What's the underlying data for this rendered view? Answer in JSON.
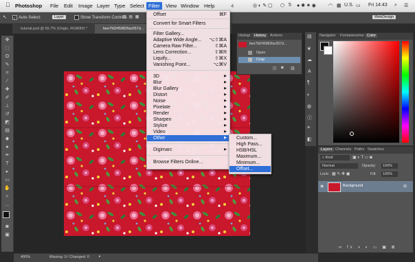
{
  "menubar": {
    "apple": "",
    "items": [
      "Photoshop",
      "File",
      "Edit",
      "Image",
      "Layer",
      "Type",
      "Select",
      "Filter",
      "View",
      "Window",
      "Help"
    ],
    "partial_title": "4",
    "tray": {
      "flag": "U.S.",
      "clock": "Fri 14:43",
      "badge": "5"
    }
  },
  "optionsbar": {
    "auto_select": "Auto-Select:",
    "auto_select_value": "Layer",
    "transform": "Show Transform Controls",
    "workspace": "WebDesign"
  },
  "doc_tabs": [
    "tutorial.psd @ 66.7% (Origin, RGB/8#) *",
    "bee7fd245982fac057d..."
  ],
  "filter_menu": {
    "items": [
      {
        "label": "Offset",
        "shortcut": "⌘F"
      },
      {
        "label": "Convert for Smart Filters",
        "shortcut": ""
      },
      {
        "label": "Filter Gallery...",
        "shortcut": ""
      },
      {
        "label": "Adaptive Wide Angle...",
        "shortcut": "⌥⇧⌘A"
      },
      {
        "label": "Camera Raw Filter...",
        "shortcut": "⇧⌘A"
      },
      {
        "label": "Lens Correction...",
        "shortcut": "⇧⌘R"
      },
      {
        "label": "Liquify...",
        "shortcut": "⇧⌘X"
      },
      {
        "label": "Vanishing Point...",
        "shortcut": "⌥⌘V"
      },
      {
        "label": "3D",
        "shortcut": ""
      },
      {
        "label": "Blur",
        "shortcut": ""
      },
      {
        "label": "Blur Gallery",
        "shortcut": ""
      },
      {
        "label": "Distort",
        "shortcut": ""
      },
      {
        "label": "Noise",
        "shortcut": ""
      },
      {
        "label": "Pixelate",
        "shortcut": ""
      },
      {
        "label": "Render",
        "shortcut": ""
      },
      {
        "label": "Sharpen",
        "shortcut": ""
      },
      {
        "label": "Stylize",
        "shortcut": ""
      },
      {
        "label": "Video",
        "shortcut": ""
      },
      {
        "label": "Other",
        "shortcut": ""
      },
      {
        "label": "Digimarc",
        "shortcut": ""
      },
      {
        "label": "Browse Filters Online...",
        "shortcut": ""
      }
    ]
  },
  "other_submenu": {
    "items": [
      "Custom...",
      "High Pass...",
      "HSB/HSL",
      "Maximum...",
      "Minimum...",
      "Offset..."
    ]
  },
  "history_panel": {
    "tabs": [
      "Histogr",
      "History",
      "Actions"
    ],
    "snapshot": "bee7fd245982fac057d...",
    "states": [
      "Open",
      "Crop"
    ]
  },
  "color_panel": {
    "tabs": [
      "Navigator",
      "Fontawesome",
      "Color"
    ]
  },
  "layers_panel": {
    "tabs": [
      "Layers",
      "Channels",
      "Paths",
      "Swatches"
    ],
    "filter_kind": "Kind",
    "blend_mode": "Normal",
    "opacity_label": "Opacity:",
    "opacity_value": "100%",
    "lock_label": "Lock:",
    "fill_label": "Fill:",
    "fill_value": "100%",
    "layer_name": "Background"
  },
  "statusbar": {
    "zoom": "400%",
    "info": "Missing: 0 / Changed: 0"
  },
  "colors": {
    "accent": "#2f6fd7",
    "fabric": "#c9172b",
    "panel": "#535353"
  }
}
